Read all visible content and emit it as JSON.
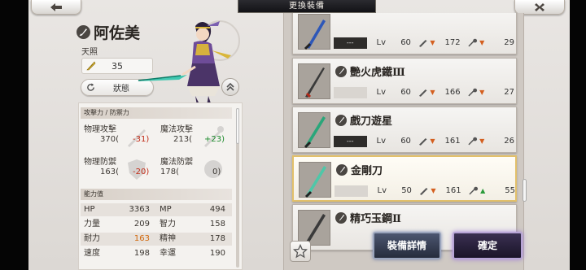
{
  "header": {
    "title": "更換裝備"
  },
  "character": {
    "name": "阿佐美",
    "title": "天照",
    "level": "35",
    "status_button": "狀態"
  },
  "stats": {
    "attack_header": "攻擊力 / 防禦力",
    "phys_atk": {
      "label": "物理攻擊",
      "value": "370(",
      "diff": "-31)"
    },
    "mag_atk": {
      "label": "魔法攻擊",
      "value": "213(",
      "diff": "+23)"
    },
    "phys_def": {
      "label": "物理防禦",
      "value": "163(",
      "diff": "-20)"
    },
    "mag_def": {
      "label": "魔法防禦",
      "value": "178(",
      "diff": "0)"
    },
    "ability_header": "能力值",
    "abilities": [
      {
        "l1": "HP",
        "v1": "3363",
        "l2": "MP",
        "v2": "494"
      },
      {
        "l1": "力量",
        "v1": "209",
        "l2": "智力",
        "v2": "158"
      },
      {
        "l1": "耐力",
        "v1": "163",
        "l2": "精神",
        "v2": "178"
      },
      {
        "l1": "速度",
        "v1": "198",
        "l2": "幸運",
        "v2": "190"
      }
    ]
  },
  "equipment": [
    {
      "name": "",
      "owner": "---",
      "lv_label": "Lv",
      "lv": "60",
      "atk": "172",
      "atk_dir": "down",
      "def": "29",
      "def_dir": "down"
    },
    {
      "name": "艷火虎鐵Ⅲ",
      "owner": "",
      "lv_label": "Lv",
      "lv": "60",
      "atk": "166",
      "atk_dir": "down",
      "def": "27",
      "def_dir": "down"
    },
    {
      "name": "戲刀遊星",
      "owner": "---",
      "lv_label": "Lv",
      "lv": "60",
      "atk": "161",
      "atk_dir": "down",
      "def": "26",
      "def_dir": "down"
    },
    {
      "name": "金剛刀",
      "owner": "",
      "lv_label": "Lv",
      "lv": "50",
      "atk": "161",
      "atk_dir": "down",
      "def": "55",
      "def_dir": "up"
    },
    {
      "name": "精巧玉鋼Ⅱ",
      "owner": "",
      "lv_label": "",
      "lv": "",
      "atk": "",
      "atk_dir": "",
      "def": "",
      "def_dir": ""
    }
  ],
  "buttons": {
    "details": "裝備詳情",
    "confirm": "確定"
  },
  "icons": {
    "back": "back-arrow-icon",
    "close": "close-x-icon",
    "feather": "feather-icon",
    "refresh": "refresh-icon",
    "star": "star-icon",
    "expand": "double-chevron-up-icon"
  }
}
